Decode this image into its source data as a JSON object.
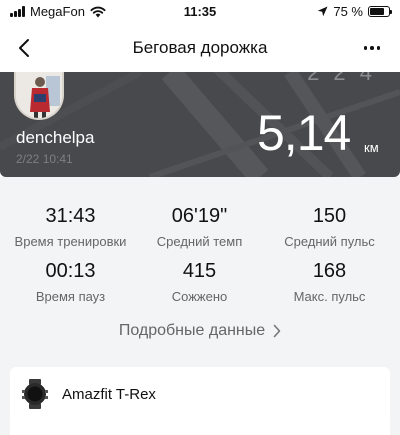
{
  "status_bar": {
    "carrier": "MegaFon",
    "time": "11:35",
    "battery_percent_label": "75 %",
    "battery_level": 0.75,
    "icons": [
      "signal-icon",
      "wifi-icon",
      "location-arrow-icon",
      "battery-icon"
    ]
  },
  "nav": {
    "title": "Беговая дорожка",
    "icons": [
      "back-chevron-icon",
      "more-icon"
    ]
  },
  "workout": {
    "username": "denchelpa",
    "date": "2/22 10:41",
    "distance": "5,14",
    "distance_unit": "км",
    "cropped_text": "2 2 4"
  },
  "stats": [
    {
      "value": "31:43",
      "label": "Время тренировки"
    },
    {
      "value": "06'19\"",
      "label": "Средний темп"
    },
    {
      "value": "150",
      "label": "Средний пульс"
    },
    {
      "value": "00:13",
      "label": "Время пауз"
    },
    {
      "value": "415",
      "label": "Сожжено"
    },
    {
      "value": "168",
      "label": "Макс. пульс"
    }
  ],
  "details_link": "Подробные данные",
  "device": {
    "name": "Amazfit T-Rex",
    "icon": "watch-icon"
  }
}
